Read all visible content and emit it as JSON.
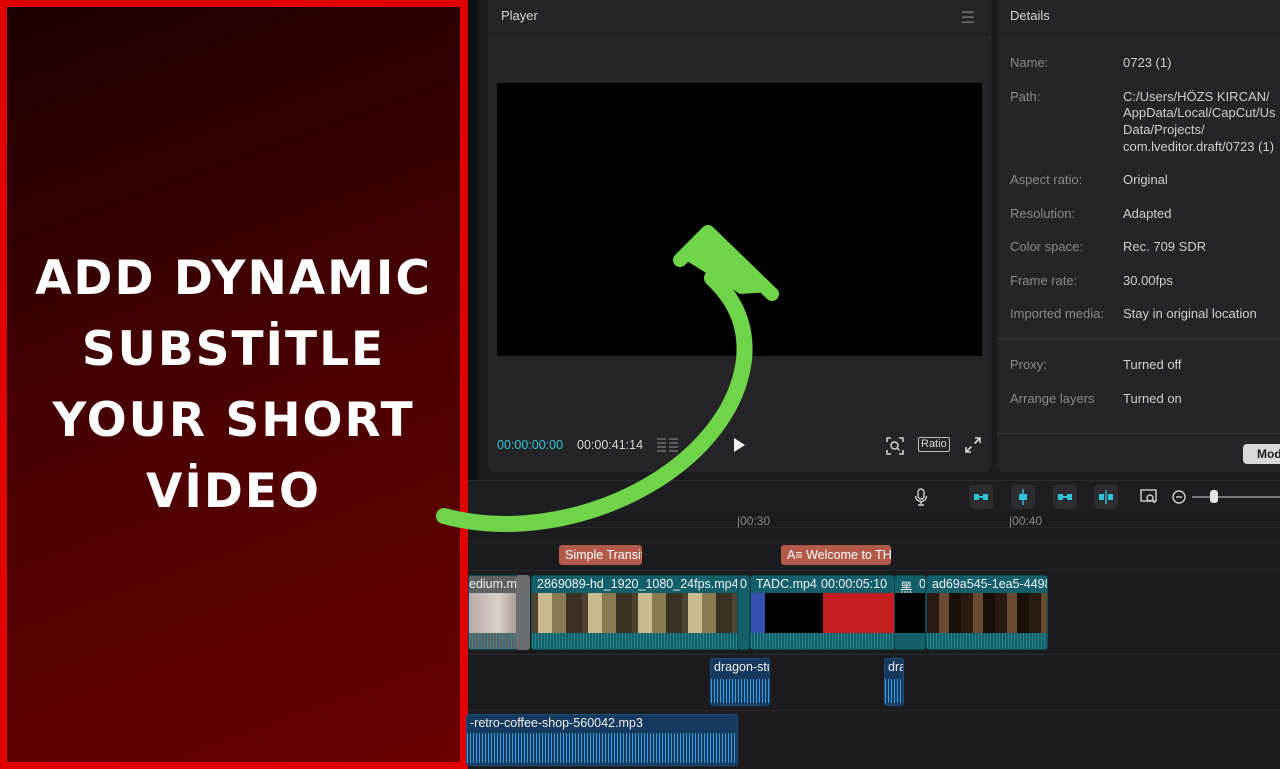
{
  "banner": {
    "lines": [
      "ADD DYNAMIC",
      "SUBSTİTLE",
      "YOUR SHORT",
      "VİDEO"
    ]
  },
  "player": {
    "title": "Player",
    "current_time": "00:00:00:00",
    "total_time": "00:00:41:14",
    "ratio_label": "Ratio"
  },
  "details": {
    "title": "Details",
    "rows": [
      {
        "label": "Name:",
        "value": "0723 (1)"
      },
      {
        "label": "Path:",
        "value_lines": [
          "C:/Users/HÖZS KIRCAN/",
          "AppData/Local/CapCut/Us",
          "Data/Projects/",
          "com.lveditor.draft/0723 (1)"
        ]
      },
      {
        "label": "Aspect ratio:",
        "value": "Original"
      },
      {
        "label": "Resolution:",
        "value": "Adapted"
      },
      {
        "label": "Color space:",
        "value": "Rec. 709 SDR"
      },
      {
        "label": "Frame rate:",
        "value": "30.00fps"
      },
      {
        "label": "Imported media:",
        "value": "Stay in original location"
      },
      {
        "label": "Proxy:",
        "value": "Turned off"
      },
      {
        "label": "Arrange layers",
        "value": "Turned on"
      }
    ],
    "modify_button": "Mod"
  },
  "timeline": {
    "ruler_ticks": [
      "|00:30",
      "|00:40"
    ],
    "transitions": [
      "Simple Transit",
      "A≡ Welcome to TH"
    ],
    "video_clips": [
      {
        "label": "edium.m"
      },
      {
        "label": "2869089-hd_1920_1080_24fps.mp4"
      },
      {
        "label": "0"
      },
      {
        "label": "TADC.mp4"
      },
      {
        "label": "00:00:05:10"
      },
      {
        "label": "黑"
      },
      {
        "label": "0"
      },
      {
        "label": "ad69a545-1ea5-4498"
      }
    ],
    "audio_clips": [
      {
        "label": "dragon-stu"
      },
      {
        "label": "dra"
      },
      {
        "label": "-retro-coffee-shop-560042.mp3"
      }
    ]
  },
  "colors": {
    "accent": "#2ec4d6",
    "banner_border": "#e00000",
    "arrow": "#6fd44a",
    "video_clip": "#13606a",
    "audio_clip": "#163a5f",
    "transition_clip": "#b35a4b"
  }
}
